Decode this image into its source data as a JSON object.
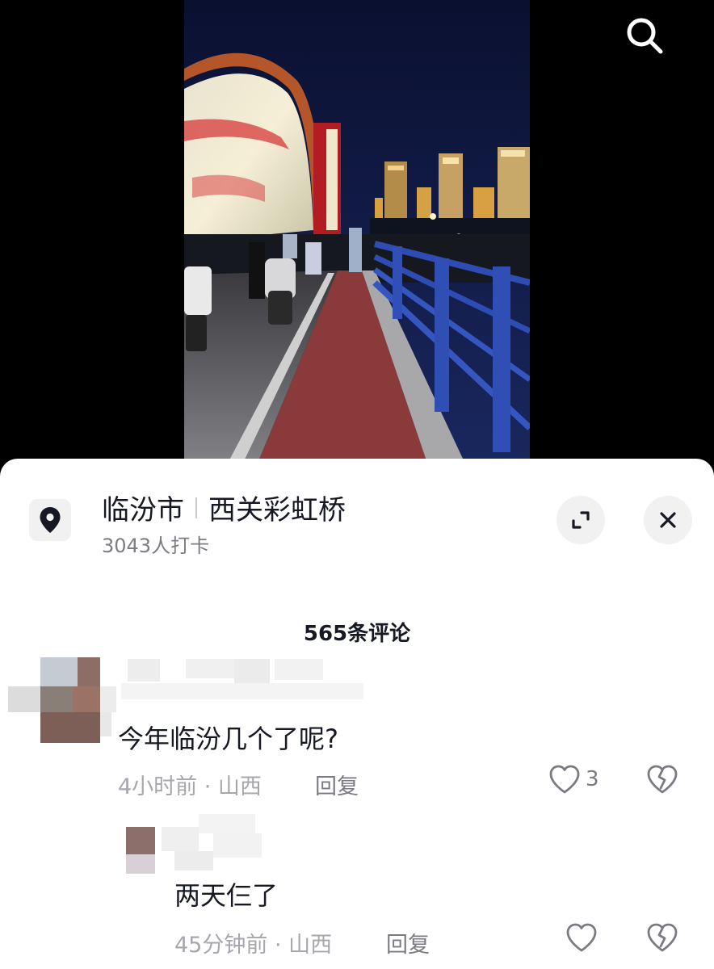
{
  "video": {
    "search_icon": "search-icon"
  },
  "location": {
    "city": "临汾市",
    "place": "西关彩虹桥",
    "checkins": "3043人打卡",
    "pin_icon": "location-pin-icon",
    "expand_icon": "expand-icon",
    "close_icon": "close-icon"
  },
  "comments_header": {
    "count_label": "565条评论"
  },
  "comments": [
    {
      "text": "今年临汾几个了呢?",
      "time_location": "4小时前 · 山西",
      "reply_label": "回复",
      "likes": "3"
    }
  ],
  "replies": [
    {
      "text": "两天仨了",
      "time_location": "45分钟前 · 山西",
      "reply_label": "回复"
    }
  ]
}
